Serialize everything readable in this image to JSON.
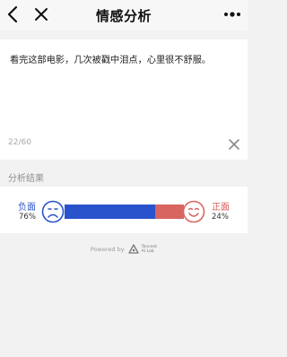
{
  "nav": {
    "title": "情感分析",
    "back_icon": "chevron-left-icon",
    "close_icon": "close-icon",
    "more_icon": "more-dots-icon"
  },
  "input": {
    "text": "看完这部电影，几次被戳中泪点，心里很不舒服。",
    "counter": "22/60",
    "clear_icon": "clear-x-icon"
  },
  "result": {
    "section_title": "分析结果",
    "negative": {
      "label": "负面",
      "value": "76%",
      "fraction": 0.76,
      "color": "#2853cc",
      "icon": "sad-face-icon"
    },
    "positive": {
      "label": "正面",
      "value": "24%",
      "fraction": 0.24,
      "color": "#d8655f",
      "icon": "happy-face-icon"
    }
  },
  "footer": {
    "powered_by": "Powered by",
    "logo_text_1": "Tencent",
    "logo_text_2": "AI Lab"
  }
}
